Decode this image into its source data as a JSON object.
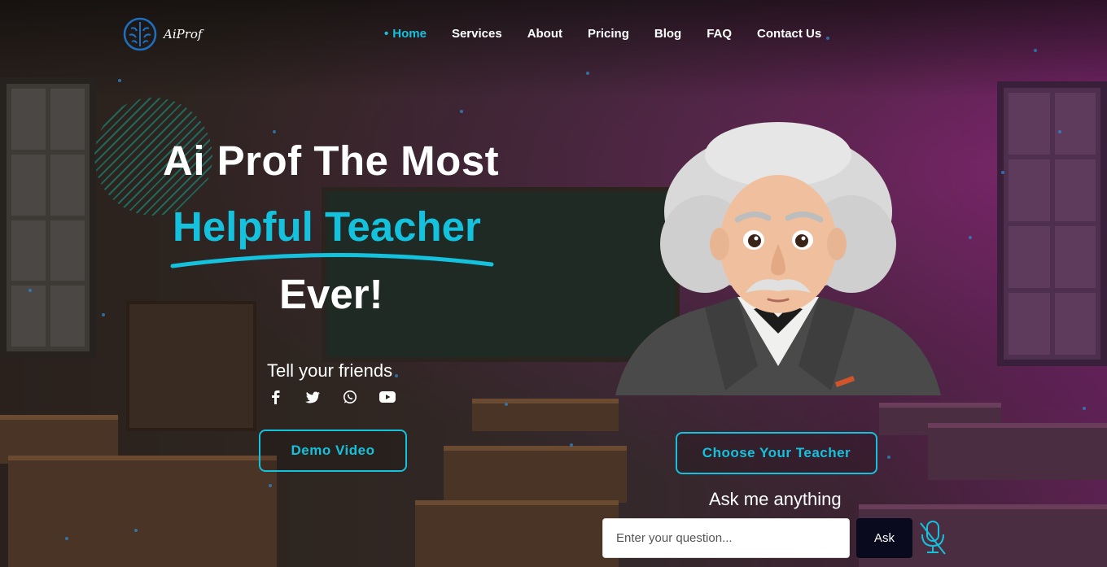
{
  "brand": {
    "name": "AiProf",
    "accent": "#14c2dd",
    "logo_icon": "brain-icon"
  },
  "nav": {
    "items": [
      {
        "label": "Home",
        "active": true
      },
      {
        "label": "Services",
        "active": false
      },
      {
        "label": "About",
        "active": false
      },
      {
        "label": "Pricing",
        "active": false
      },
      {
        "label": "Blog",
        "active": false
      },
      {
        "label": "FAQ",
        "active": false
      },
      {
        "label": "Contact Us",
        "active": false
      }
    ]
  },
  "hero": {
    "line1": "Ai Prof The Most",
    "line2": "Helpful Teacher",
    "line3": "Ever!",
    "share_label": "Tell your friends",
    "socials": [
      "facebook-icon",
      "twitter-icon",
      "whatsapp-icon",
      "youtube-icon"
    ],
    "demo_button": "Demo Video",
    "choose_button": "Choose Your Teacher"
  },
  "ask": {
    "title": "Ask me anything",
    "placeholder": "Enter your question...",
    "button": "Ask",
    "mic_icon": "microphone-icon"
  }
}
